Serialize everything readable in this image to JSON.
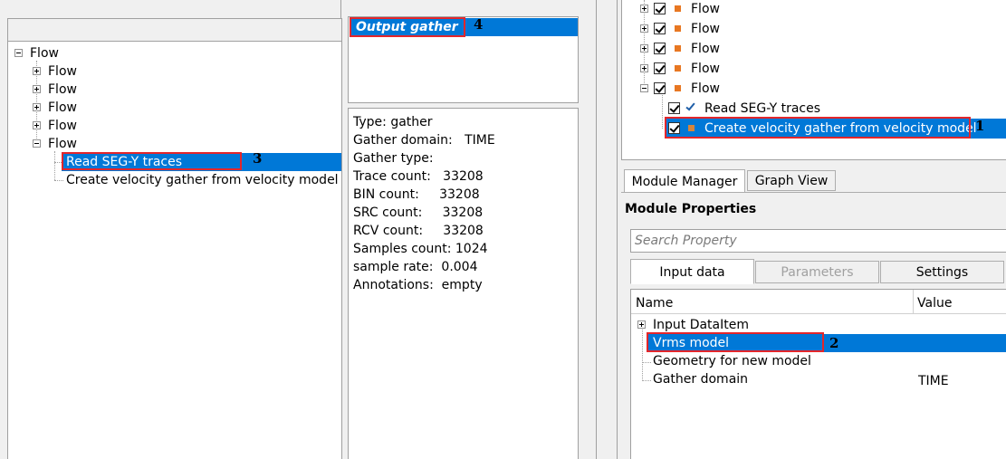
{
  "left_tree": {
    "root": "Flow",
    "items": [
      "Flow",
      "Flow",
      "Flow",
      "Flow",
      "Flow"
    ],
    "children": [
      "Read SEG-Y traces",
      "Create velocity gather from velocity model"
    ]
  },
  "output": {
    "item": "Output gather"
  },
  "info": {
    "lines": [
      "Type: gather",
      "Gather domain:   TIME",
      "Gather type:",
      "Trace count:   33208",
      "BIN count:     33208",
      "SRC count:     33208",
      "RCV count:     33208",
      "Samples count: 1024",
      "sample rate:  0.004",
      "Annotations:  empty"
    ]
  },
  "right_tree": {
    "items": [
      "Flow",
      "Flow",
      "Flow",
      "Flow",
      "Flow"
    ],
    "children": [
      "Read SEG-Y traces",
      "Create velocity gather from velocity model"
    ]
  },
  "tabs": {
    "module_manager": "Module Manager",
    "graph_view": "Graph View"
  },
  "props": {
    "title": "Module Properties",
    "search_placeholder": "Search Property",
    "tabs": [
      "Input data",
      "Parameters",
      "Settings"
    ],
    "col_name": "Name",
    "col_value": "Value",
    "rows": [
      {
        "name": "Input DataItem",
        "value": ""
      },
      {
        "name": "Vrms model",
        "value": ""
      },
      {
        "name": "Geometry for new model",
        "value": ""
      },
      {
        "name": "Gather domain",
        "value": "TIME"
      }
    ]
  },
  "badges": [
    "1",
    "2",
    "3",
    "4"
  ],
  "colors": {
    "selection": "#0078d7",
    "highlight_border": "#e3262b",
    "flow_icon": "#e87722"
  }
}
